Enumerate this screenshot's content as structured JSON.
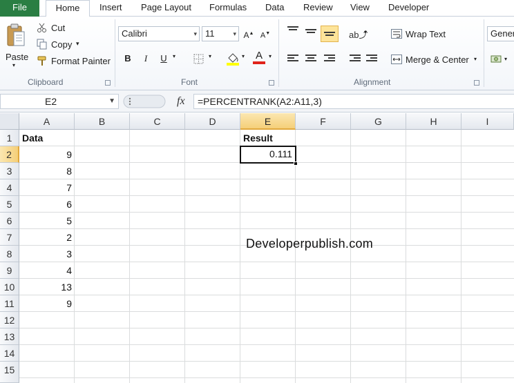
{
  "ribbon_tabs": {
    "file": "File",
    "home": "Home",
    "insert": "Insert",
    "page_layout": "Page Layout",
    "formulas": "Formulas",
    "data": "Data",
    "review": "Review",
    "view": "View",
    "developer": "Developer"
  },
  "clipboard": {
    "paste": "Paste",
    "cut": "Cut",
    "copy": "Copy",
    "format_painter": "Format Painter",
    "label": "Clipboard"
  },
  "font": {
    "name": "Calibri",
    "size": "11",
    "bold": "B",
    "italic": "I",
    "underline": "U",
    "label": "Font",
    "highlight_color": "#ffff00",
    "font_color": "#e0231b"
  },
  "alignment": {
    "wrap_text": "Wrap Text",
    "merge_center": "Merge & Center",
    "label": "Alignment"
  },
  "number": {
    "format": "Gener"
  },
  "formula_bar": {
    "name_box": "E2",
    "fx": "fx",
    "formula": "=PERCENTRANK(A2:A11,3)"
  },
  "columns": [
    "A",
    "B",
    "C",
    "D",
    "E",
    "F",
    "G",
    "H",
    "I"
  ],
  "rows": [
    "1",
    "2",
    "3",
    "4",
    "5",
    "6",
    "7",
    "8",
    "9",
    "10",
    "11",
    "12",
    "13",
    "14",
    "15"
  ],
  "cells": {
    "A1": "Data",
    "A2": "9",
    "A3": "8",
    "A4": "7",
    "A5": "6",
    "A6": "5",
    "A7": "2",
    "A8": "3",
    "A9": "4",
    "A10": "13",
    "A11": "9",
    "E1": "Result",
    "E2": "0.111"
  },
  "watermark": "Developerpublish.com",
  "colors": {
    "file_tab": "#2a7e43",
    "selected_header": "#f5cf79"
  }
}
